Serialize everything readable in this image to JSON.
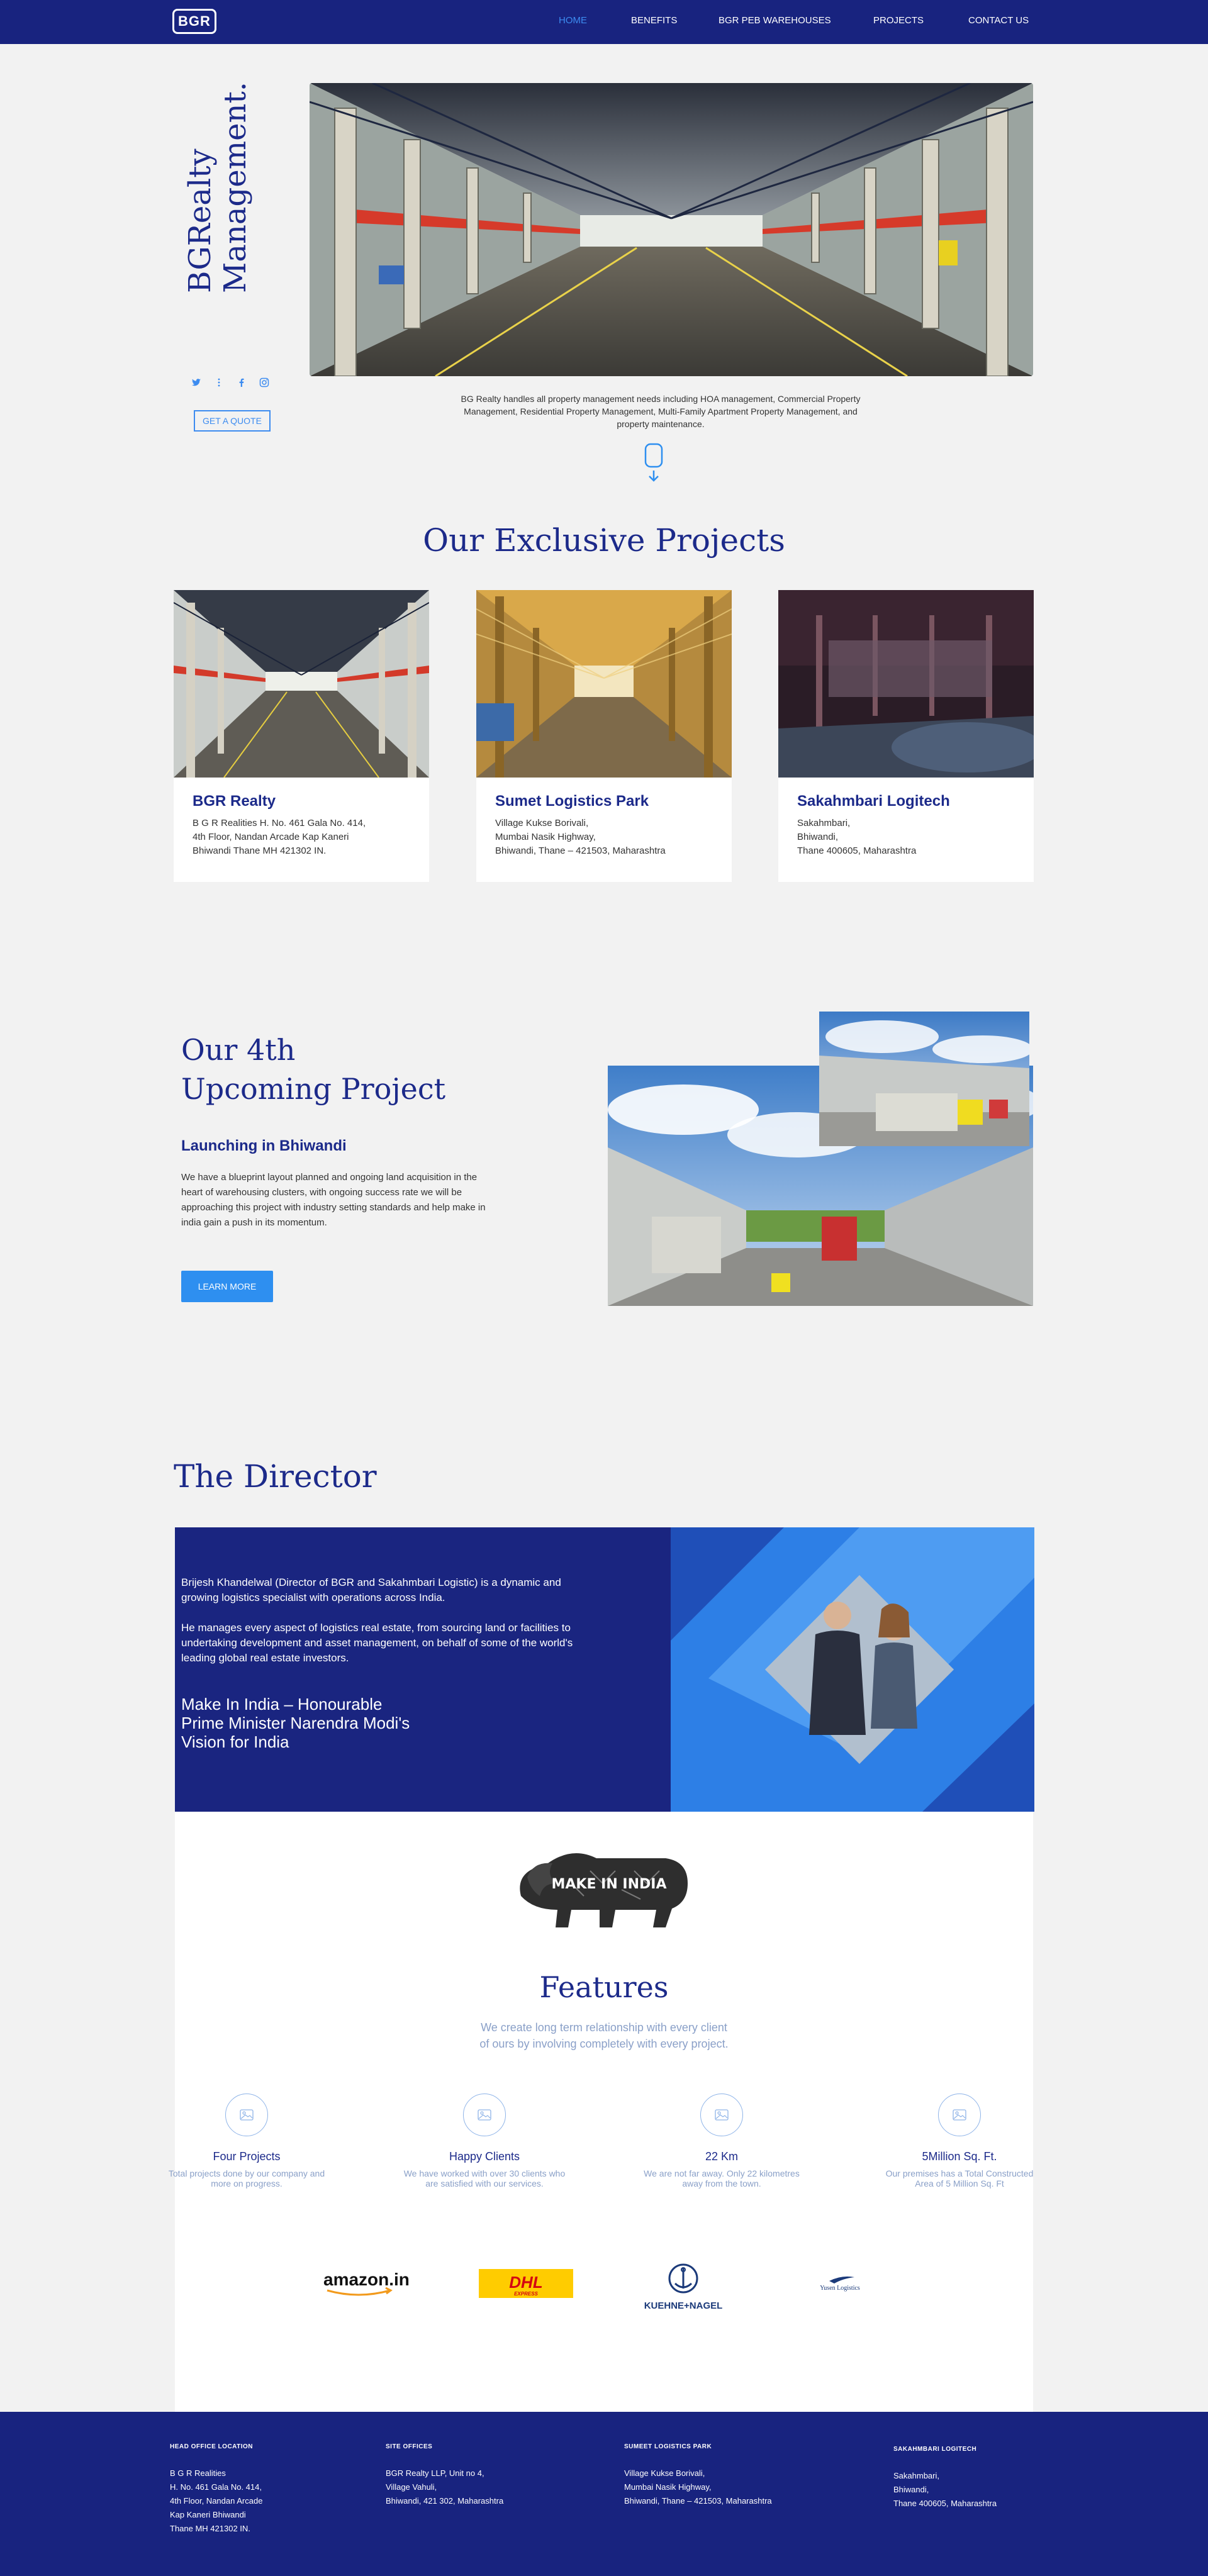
{
  "nav": {
    "logo": "BGR",
    "items": [
      {
        "label": "HOME",
        "active": true
      },
      {
        "label": "BENEFITS",
        "active": false
      },
      {
        "label": "BGR PEB WAREHOUSES",
        "active": false
      },
      {
        "label": "PROJECTS",
        "active": false
      },
      {
        "label": "CONTACT US",
        "active": false
      }
    ]
  },
  "hero": {
    "title_line1": "BGRealty",
    "title_line2": "Management.",
    "social_icons": [
      "twitter-icon",
      "more-vertical-icon",
      "facebook-icon",
      "instagram-icon"
    ],
    "quote_button": "GET A QUOTE",
    "description": "BG Realty handles all property management needs including HOA management, Commercial Property Management, Residential Property Management, Multi-Family Apartment Property Management, and property maintenance."
  },
  "projects": {
    "title": "Our Exclusive Projects",
    "cards": [
      {
        "title": "BGR Realty",
        "lines": [
          "B G R Realities H. No. 461 Gala No. 414,",
          "4th Floor, Nandan  Arcade Kap Kaneri",
          "Bhiwandi  Thane MH 421302 IN."
        ]
      },
      {
        "title": "Sumet Logistics Park",
        "lines": [
          "Village Kukse Borivali,",
          "Mumbai Nasik Highway,",
          "Bhiwandi, Thane – 421503, Maharashtra"
        ]
      },
      {
        "title": "Sakahmbari Logitech",
        "lines": [
          "Sakahmbari,",
          "Bhiwandi,",
          "Thane 400605, Maharashtra"
        ]
      }
    ]
  },
  "upcoming": {
    "title_line1": "Our 4th",
    "title_line2": "Upcoming Project",
    "subtitle": "Launching in Bhiwandi",
    "description": "We have a blueprint layout planned and ongoing land acquisition in the heart of warehousing clusters, with ongoing success rate we will be approaching this project with industry setting standards and help make in india gain a push in its momentum.",
    "button": "LEARN MORE"
  },
  "director": {
    "title": "The Director",
    "para1": "Brijesh Khandelwal (Director of BGR and Sakahmbari Logistic) is a dynamic and growing logistics specialist with operations across India.",
    "para2": "He manages every aspect of logistics real estate, from sourcing land or facilities to undertaking development and asset management, on behalf of some of the world's leading global real estate investors.",
    "quote_line1": "Make In India – Honourable",
    "quote_line2": "Prime Minister Narendra Modi's",
    "quote_line3": "Vision for India",
    "make_in_india": "MAKE IN INDIA"
  },
  "features": {
    "title": "Features",
    "subtitle": "We create long term relationship with every client of ours by involving completely with every project.",
    "items": [
      {
        "title": "Four Projects",
        "desc": "Total projects done by our company and more on progress."
      },
      {
        "title": "Happy Clients",
        "desc": "We have worked with over 30 clients who are satisfied with our services."
      },
      {
        "title": "22 Km",
        "desc": "We are not far away. Only 22 kilometres away from the town."
      },
      {
        "title": "5Million Sq. Ft.",
        "desc": "Our premises has a Total Constructed Area of 5 Million Sq. Ft"
      }
    ]
  },
  "brands": {
    "amazon": "amazon.in",
    "dhl": "DHL",
    "dhl_sub": "EXPRESS",
    "kuehne": "KUEHNE+NAGEL",
    "yusen": "Yusen Logistics"
  },
  "footer": {
    "cols": [
      {
        "heading": "HEAD OFFICE LOCATION",
        "lines": [
          "B G R Realities",
          "H. No. 461 Gala No. 414,",
          "4th Floor, Nandan  Arcade",
          "Kap Kaneri Bhiwandi",
          "Thane MH 421302 IN."
        ]
      },
      {
        "heading": "SITE OFFICES",
        "lines": [
          "BGR Realty LLP, Unit no 4,",
          "Village Vahuli,",
          "Bhiwandi, 421 302, Maharashtra"
        ]
      },
      {
        "heading": "SUMEET LOGISTICS PARK",
        "lines": [
          "Village Kukse Borivali,",
          "Mumbai Nasik Highway,",
          "Bhiwandi, Thane – 421503, Maharashtra"
        ]
      },
      {
        "heading": "SAKAHMBARI LOGITECH",
        "lines": [
          "Sakahmbari,",
          "Bhiwandi,",
          "Thane 400605, Maharashtra"
        ]
      }
    ]
  }
}
